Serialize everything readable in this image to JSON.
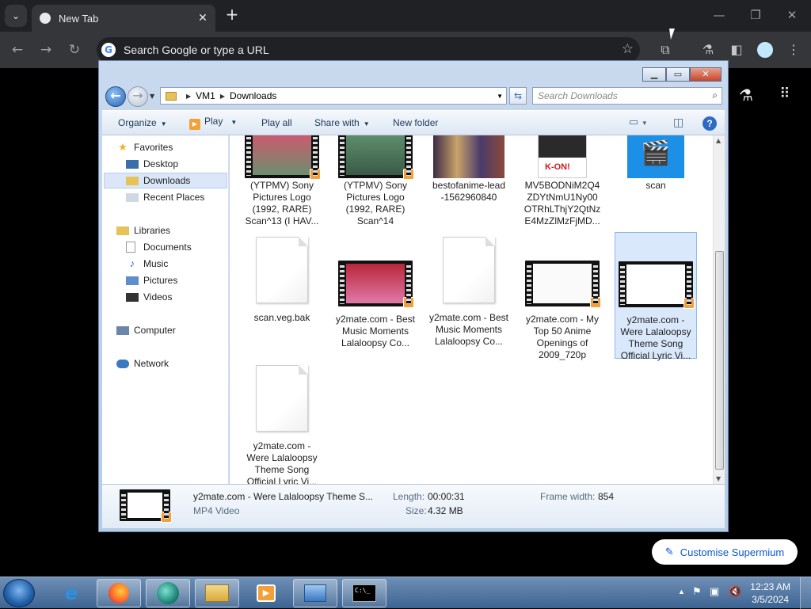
{
  "chrome": {
    "tab_title": "New Tab",
    "omnibox_placeholder": "Search Google or type a URL",
    "customise_label": "Customise Supermium"
  },
  "explorer": {
    "breadcrumb": [
      "VM1",
      "Downloads"
    ],
    "search_placeholder": "Search Downloads",
    "commands": {
      "organize": "Organize",
      "play": "Play",
      "play_all": "Play all",
      "share_with": "Share with",
      "new_folder": "New folder"
    },
    "nav": {
      "favorites": "Favorites",
      "desktop": "Desktop",
      "downloads": "Downloads",
      "recent": "Recent Places",
      "libraries": "Libraries",
      "documents": "Documents",
      "music": "Music",
      "pictures": "Pictures",
      "videos": "Videos",
      "computer": "Computer",
      "network": "Network"
    },
    "files": [
      {
        "name": "(YTPMV) Sony Pictures Logo (1992, RARE) Scan^13 (I HAV...",
        "kind": "video"
      },
      {
        "name": "(YTPMV) Sony Pictures Logo (1992, RARE) Scan^14",
        "kind": "video"
      },
      {
        "name": "bestofanime-lead -1562960840",
        "kind": "image"
      },
      {
        "name": "MV5BODNiM2Q4 ZDYtNmU1Ny00 OTRhLThjY2QtNz E4MzZlMzFjMD...",
        "kind": "image"
      },
      {
        "name": "scan",
        "kind": "app"
      },
      {
        "name": "scan.veg.bak",
        "kind": "doc"
      },
      {
        "name": "y2mate.com - Best Music Moments Lalaloopsy Co...",
        "kind": "video"
      },
      {
        "name": "y2mate.com - Best Music Moments Lalaloopsy Co...",
        "kind": "doc"
      },
      {
        "name": "y2mate.com - My Top 50 Anime Openings of 2009_720p",
        "kind": "video"
      },
      {
        "name": "y2mate.com - Were Lalaloopsy Theme Song Official Lyric Vi...",
        "kind": "video",
        "selected": true
      },
      {
        "name": "y2mate.com - Were Lalaloopsy Theme Song Official Lyric Vi...",
        "kind": "doc"
      }
    ],
    "details": {
      "name": "y2mate.com - Were Lalaloopsy Theme S...",
      "type": "MP4 Video",
      "length_label": "Length:",
      "length": "00:00:31",
      "size_label": "Size:",
      "size": "4.32 MB",
      "frame_width_label": "Frame width:",
      "frame_width": "854"
    }
  },
  "taskbar": {
    "time": "12:23 AM",
    "date": "3/5/2024"
  }
}
